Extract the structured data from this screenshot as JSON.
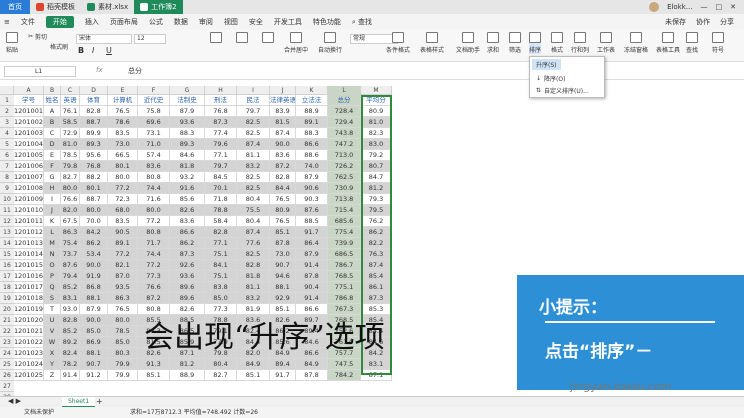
{
  "titlebar": {
    "home": "首页",
    "tabs": [
      "稻壳模板",
      "素材.xlsx",
      "工作簿2"
    ],
    "user": "Elokk..."
  },
  "menubar": {
    "file": "文件",
    "items": [
      "开始",
      "插入",
      "页面布局",
      "公式",
      "数据",
      "审阅",
      "视图",
      "安全",
      "开发工具",
      "特色功能"
    ],
    "search": "查找",
    "right": [
      "未保存",
      "协作",
      "分享"
    ]
  },
  "ribbon": {
    "paste": "粘贴",
    "cut": "剪切",
    "format_painter": "格式刷",
    "font_name": "宋体",
    "font_size": "12",
    "bold": "B",
    "italic": "I",
    "underline": "U",
    "merge": "合并居中",
    "wrap": "自动换行",
    "number_format": "常规",
    "cond_format": "条件格式",
    "table_style": "表格样式",
    "doc_assist": "文档助手",
    "sum": "求和",
    "filter": "筛选",
    "sort": "排序",
    "format": "格式",
    "rowcol": "行和列",
    "worksheet": "工作表",
    "freeze": "冻结窗格",
    "table_tools": "表格工具",
    "find": "查找",
    "symbol": "符号"
  },
  "formula": {
    "cell_ref": "L1",
    "fx": "fx",
    "content": "总分"
  },
  "dropdown": {
    "header": "升序(S)",
    "items": [
      "降序(O)",
      "自定义排序(U)..."
    ]
  },
  "columns": [
    "A",
    "B",
    "C",
    "D",
    "E",
    "F",
    "G",
    "H",
    "I",
    "J",
    "K",
    "L",
    "M"
  ],
  "table": {
    "headers": [
      "学号",
      "姓名",
      "英语",
      "体育",
      "计算机",
      "近代史",
      "法制史",
      "刑法",
      "民法",
      "法律英语",
      "立法法",
      "总分",
      "平均分"
    ],
    "rows": [
      [
        "1201001",
        "A",
        "76.1",
        "82.8",
        "76.5",
        "75.8",
        "87.9",
        "76.8",
        "79.7",
        "83.9",
        "88.9",
        "728.4",
        "80.9"
      ],
      [
        "1201002",
        "B",
        "58.5",
        "88.7",
        "78.6",
        "69.6",
        "93.6",
        "87.3",
        "82.5",
        "81.5",
        "89.1",
        "729.4",
        "81.0"
      ],
      [
        "1201003",
        "C",
        "72.9",
        "89.9",
        "83.5",
        "73.1",
        "88.3",
        "77.4",
        "82.5",
        "87.4",
        "88.3",
        "743.8",
        "82.3"
      ],
      [
        "1201004",
        "D",
        "81.0",
        "89.3",
        "73.0",
        "71.0",
        "89.3",
        "79.6",
        "87.4",
        "90.0",
        "86.6",
        "747.2",
        "83.0"
      ],
      [
        "1201005",
        "E",
        "78.5",
        "95.6",
        "66.5",
        "57.4",
        "84.6",
        "77.1",
        "81.1",
        "83.6",
        "88.6",
        "713.0",
        "79.2"
      ],
      [
        "1201006",
        "F",
        "79.8",
        "76.8",
        "80.1",
        "83.6",
        "81.8",
        "79.7",
        "83.2",
        "87.2",
        "74.0",
        "726.2",
        "80.7"
      ],
      [
        "1201007",
        "G",
        "82.7",
        "88.2",
        "80.0",
        "80.8",
        "93.2",
        "84.5",
        "82.5",
        "82.8",
        "87.9",
        "762.5",
        "84.7"
      ],
      [
        "1201008",
        "H",
        "80.0",
        "80.1",
        "77.2",
        "74.4",
        "91.6",
        "70.1",
        "82.5",
        "84.4",
        "90.6",
        "730.9",
        "81.2"
      ],
      [
        "1201009",
        "I",
        "76.6",
        "88.7",
        "72.3",
        "71.6",
        "85.6",
        "71.8",
        "80.4",
        "76.5",
        "90.3",
        "713.8",
        "79.3"
      ],
      [
        "1201010",
        "J",
        "82.0",
        "80.0",
        "68.0",
        "80.0",
        "82.6",
        "78.8",
        "75.5",
        "80.9",
        "87.6",
        "715.4",
        "79.5"
      ],
      [
        "1201011",
        "K",
        "67.5",
        "70.0",
        "83.5",
        "77.2",
        "83.6",
        "58.4",
        "80.4",
        "76.5",
        "88.5",
        "685.6",
        "76.2"
      ],
      [
        "1201012",
        "L",
        "86.3",
        "84.2",
        "90.5",
        "80.8",
        "86.6",
        "82.8",
        "87.4",
        "85.1",
        "91.7",
        "775.4",
        "86.2"
      ],
      [
        "1201013",
        "M",
        "75.4",
        "86.2",
        "89.1",
        "71.7",
        "86.2",
        "77.1",
        "77.6",
        "87.8",
        "86.4",
        "739.9",
        "82.2"
      ],
      [
        "1201014",
        "N",
        "73.7",
        "53.4",
        "77.2",
        "74.4",
        "87.3",
        "75.1",
        "82.5",
        "73.0",
        "87.9",
        "686.5",
        "76.3"
      ],
      [
        "1201015",
        "O",
        "87.6",
        "90.0",
        "82.1",
        "77.2",
        "92.6",
        "84.1",
        "82.8",
        "90.7",
        "91.4",
        "786.7",
        "87.4"
      ],
      [
        "1201016",
        "P",
        "79.4",
        "91.9",
        "87.0",
        "77.3",
        "93.6",
        "75.1",
        "81.8",
        "94.6",
        "87.8",
        "768.5",
        "85.4"
      ],
      [
        "1201017",
        "Q",
        "85.2",
        "86.8",
        "93.5",
        "76.6",
        "89.6",
        "83.8",
        "81.1",
        "88.1",
        "90.4",
        "775.1",
        "86.1"
      ],
      [
        "1201018",
        "S",
        "83.1",
        "88.1",
        "86.3",
        "87.2",
        "89.6",
        "85.0",
        "83.2",
        "92.9",
        "91.4",
        "786.8",
        "87.3"
      ],
      [
        "1201019",
        "T",
        "93.0",
        "87.9",
        "76.5",
        "80.8",
        "82.6",
        "77.3",
        "81.9",
        "85.1",
        "86.6",
        "767.3",
        "85.3"
      ],
      [
        "1201020",
        "U",
        "82.8",
        "90.0",
        "80.0",
        "85.5",
        "88.5",
        "78.8",
        "83.6",
        "82.6",
        "89.7",
        "768.5",
        "85.4"
      ],
      [
        "1201021",
        "V",
        "85.2",
        "85.0",
        "78.5",
        "80.3",
        "86.5",
        "79.1",
        "82.4",
        "86.2",
        "89.4",
        "752.6",
        "84.4"
      ],
      [
        "1201022",
        "W",
        "89.2",
        "86.9",
        "85.0",
        "81.5",
        "85.9",
        "77.9",
        "84.4",
        "85.6",
        "84.6",
        "761.0",
        "84.6"
      ],
      [
        "1201023",
        "X",
        "82.4",
        "88.1",
        "80.3",
        "82.6",
        "87.1",
        "79.8",
        "82.0",
        "84.9",
        "86.6",
        "757.7",
        "84.2"
      ],
      [
        "1201024",
        "Y",
        "78.2",
        "90.7",
        "79.9",
        "91.3",
        "81.2",
        "80.4",
        "84.9",
        "89.4",
        "84.9",
        "747.5",
        "83.1"
      ],
      [
        "1201025",
        "Z",
        "91.4",
        "91.2",
        "79.9",
        "85.1",
        "88.9",
        "82.7",
        "85.1",
        "91.7",
        "87.8",
        "784.2",
        "87.1"
      ]
    ]
  },
  "extra_rows": [
    "27",
    "28"
  ],
  "caption": "会出现“升序”选项",
  "tip": {
    "title": "小提示：",
    "body": "点击“排序”－"
  },
  "watermark": "jingyan.baidu.com",
  "sheet_tab": "Sheet1",
  "status": {
    "protect": "文档未保护",
    "stats": "求和=17万8712.3  平均值=748.492  计数=26"
  },
  "colors": {
    "accent_green": "#1f8a5a",
    "tip_blue": "#2d8fd5",
    "home_blue": "#2b7cd6"
  }
}
